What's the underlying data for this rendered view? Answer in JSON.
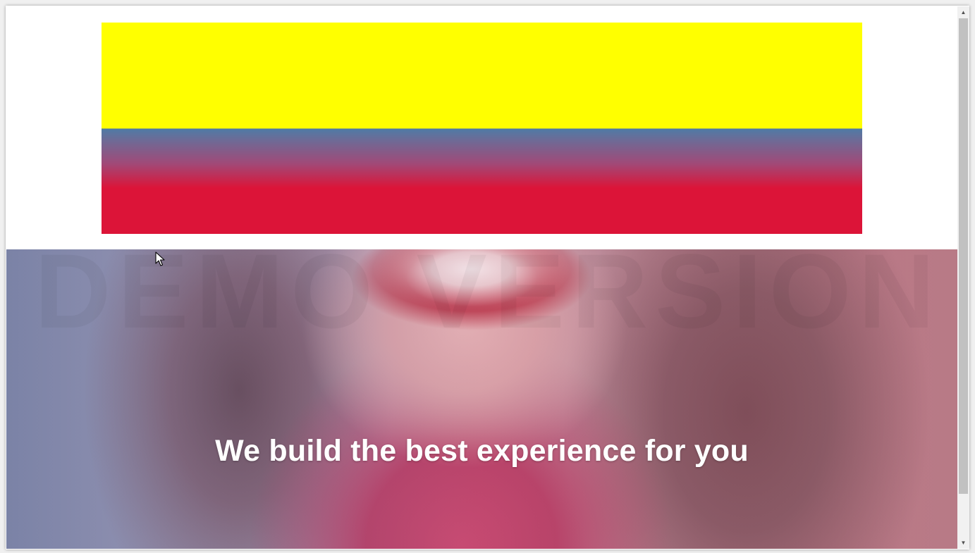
{
  "hero": {
    "title": "We build the best experience for you"
  },
  "watermark": {
    "text": "DEMO VERSION"
  },
  "banner": {
    "colors": [
      "#ffff00",
      "#4f7aa6",
      "#dc1438"
    ]
  },
  "scrollbar": {
    "up_icon": "▲",
    "down_icon": "▼"
  }
}
